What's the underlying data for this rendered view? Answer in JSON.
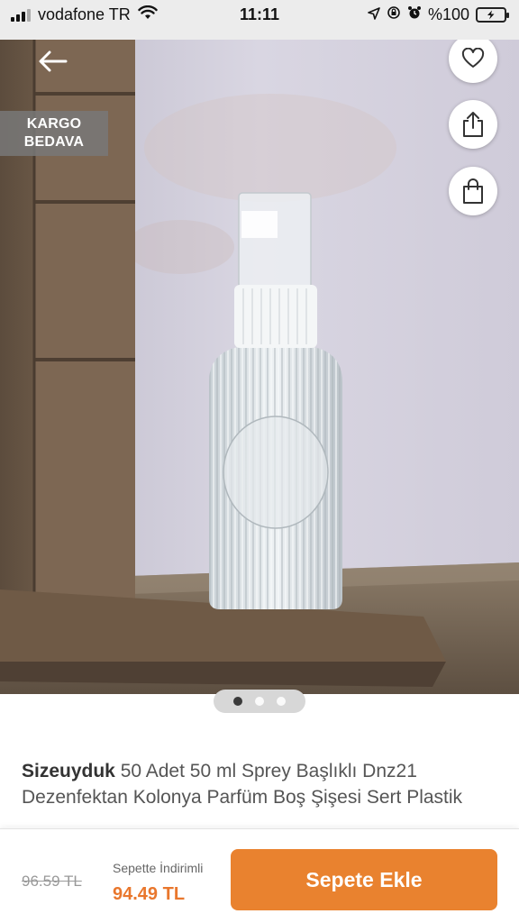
{
  "status_bar": {
    "carrier": "vodafone TR",
    "time": "11:11",
    "battery": "%100",
    "icons": [
      "signal-icon",
      "wifi-icon",
      "location-icon",
      "rotation-lock-icon",
      "alarm-icon",
      "battery-charging-icon"
    ]
  },
  "badge": {
    "line1": "KARGO",
    "line2": "BEDAVA"
  },
  "gallery": {
    "image_count": 3,
    "active_index": 0
  },
  "product": {
    "brand": "Sizeuyduk",
    "name": " 50 Adet 50 ml Sprey Başlıklı Dnz21 Dezenfektan Kolonya Parfüm Boş Şişesi Sert Plastik"
  },
  "price": {
    "old": "96.59 TL",
    "discount_label": "Sepette İndirimli",
    "new": "94.49 TL"
  },
  "actions": {
    "add_to_cart": "Sepete Ekle"
  },
  "colors": {
    "accent": "#e9822f",
    "price": "#e9772d"
  }
}
